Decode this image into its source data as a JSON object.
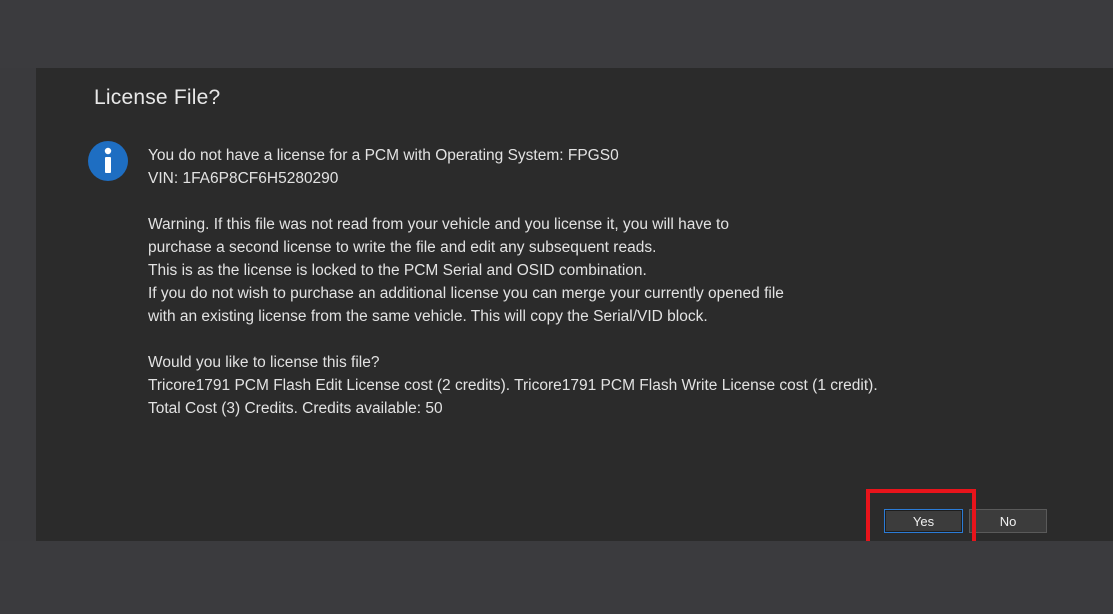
{
  "dialog": {
    "title": "License File?",
    "icon": "info-icon",
    "message_lines": [
      "You do not have a license for a PCM with Operating System: FPGS0",
      "VIN: 1FA6P8CF6H5280290",
      "",
      "Warning. If this file was not read from your vehicle and you license it, you will have to",
      "purchase a second license to write the file and edit any subsequent reads.",
      "This is as the license is locked to the PCM Serial and OSID combination.",
      "If you do not wish to purchase an additional license you can merge your currently opened file",
      "with an existing license from the same vehicle. This will copy the Serial/VID block.",
      "",
      "Would you like to license this file?",
      "Tricore1791 PCM Flash Edit License cost (2 credits). Tricore1791 PCM Flash Write License cost (1 credit).",
      "Total Cost (3) Credits. Credits available: 50"
    ],
    "buttons": {
      "yes_label": "Yes",
      "no_label": "No"
    }
  },
  "colors": {
    "dialog_bg": "#2b2b2b",
    "backdrop": "#3b3b3e",
    "icon_blue": "#1e6ec2",
    "focus_border": "#2b7bd6",
    "highlight": "#e8141b"
  }
}
